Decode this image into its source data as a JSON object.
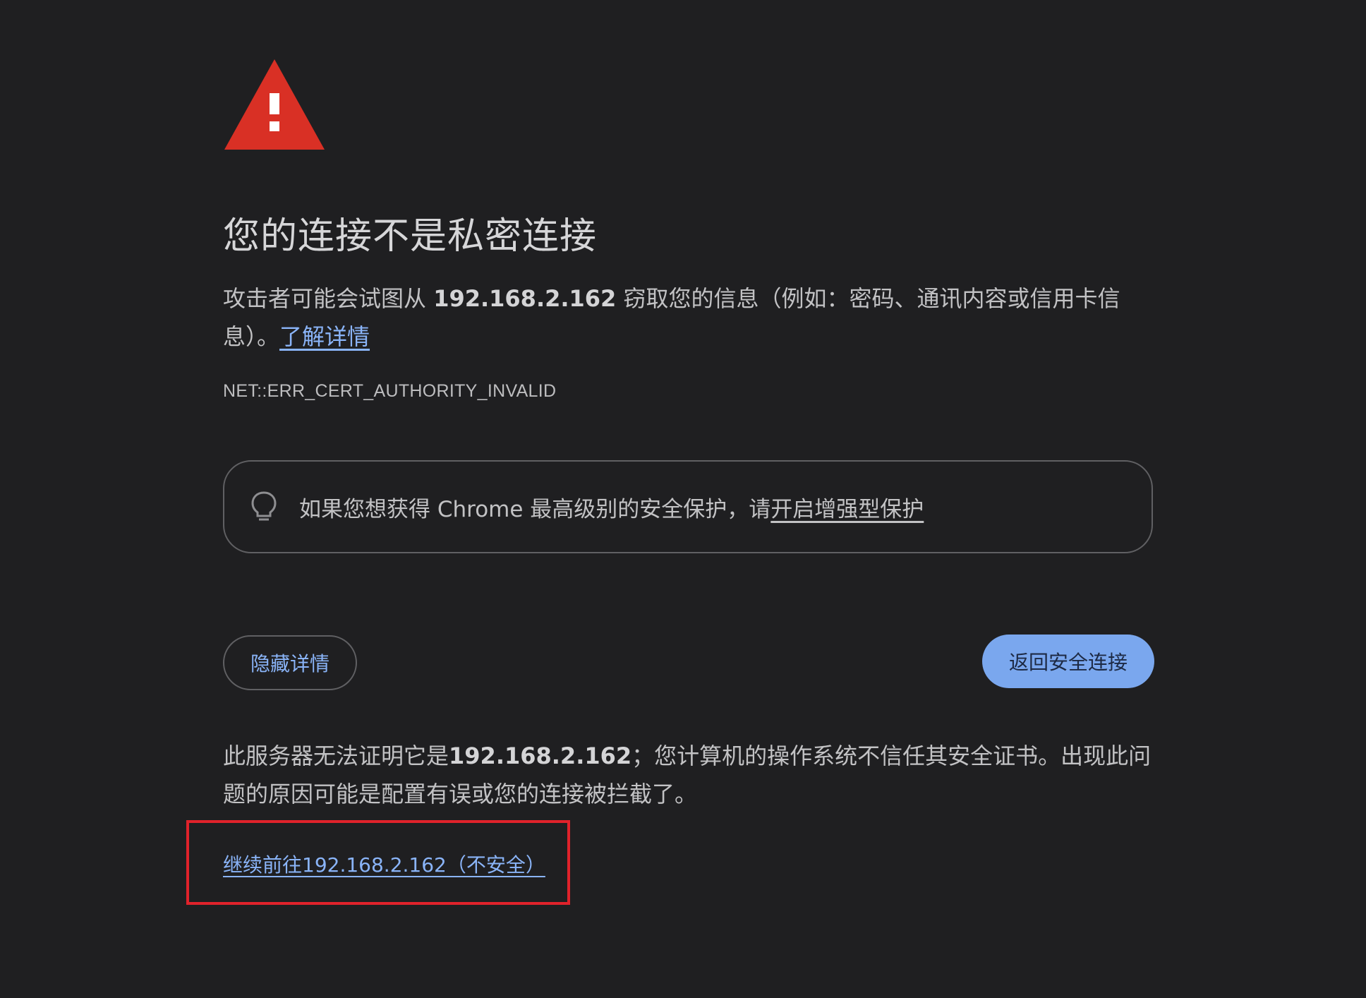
{
  "page": {
    "title": "您的连接不是私密连接",
    "description_prefix": "攻击者可能会试图从 ",
    "host": "192.168.2.162",
    "description_suffix": " 窃取您的信息（例如：密码、通讯内容或信用卡信息）。",
    "learn_more_label": "了解详情",
    "error_code": "NET::ERR_CERT_AUTHORITY_INVALID"
  },
  "tip": {
    "icon": "lightbulb-icon",
    "text": "如果您想获得 Chrome 最高级别的安全保护，请",
    "link_label": "开启增强型保护"
  },
  "buttons": {
    "hide_details_label": "隐藏详情",
    "back_to_safety_label": "返回安全连接"
  },
  "details": {
    "text_prefix": "此服务器无法证明它是",
    "host": "192.168.2.162",
    "text_suffix": "；您计算机的操作系统不信任其安全证书。出现此问题的原因可能是配置有误或您的连接被拦截了。",
    "proceed_label": "继续前往192.168.2.162（不安全）"
  },
  "colors": {
    "background": "#1f1f21",
    "link": "#8ab4f8",
    "primary_button": "#7aa7ee",
    "warning_red": "#d93025",
    "highlight_border": "#e0222b"
  }
}
